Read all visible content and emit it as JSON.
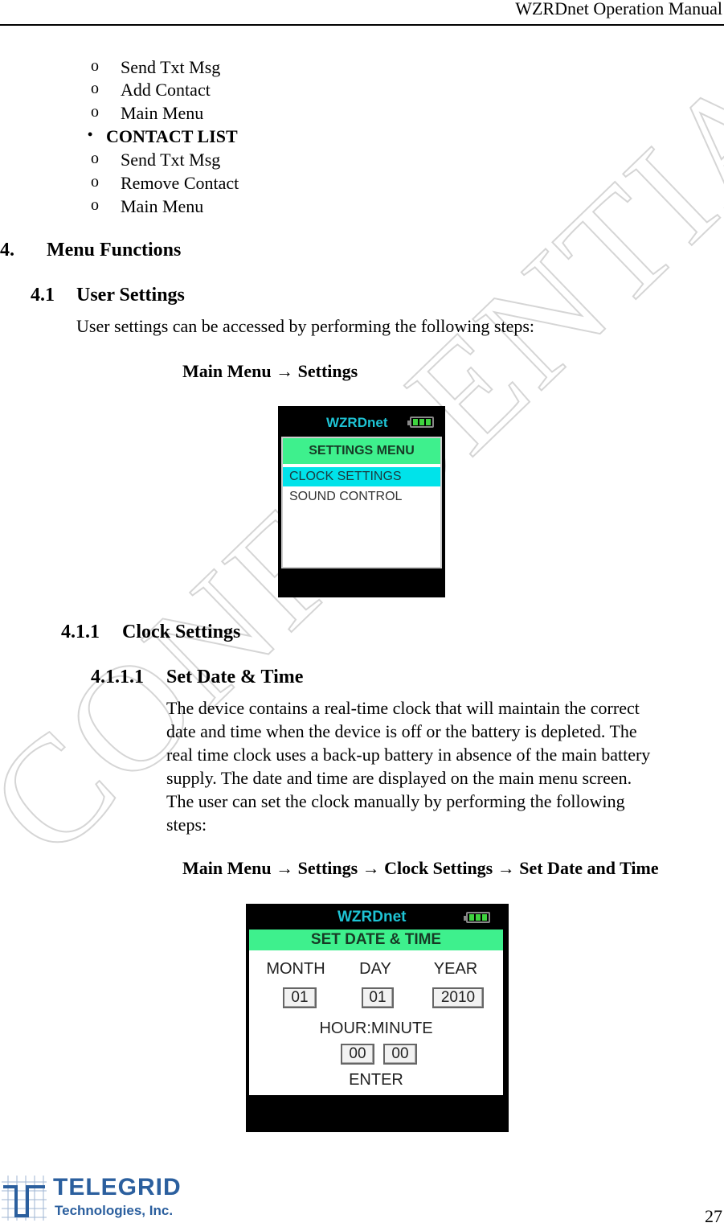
{
  "header": {
    "title": "WZRDnet Operation Manual"
  },
  "outline": {
    "top_subitems": [
      "Send Txt Msg",
      "Add Contact",
      "Main Menu"
    ],
    "contact_list": {
      "label": "CONTACT LIST",
      "subitems": [
        "Send Txt Msg",
        "Remove Contact",
        "Main Menu"
      ]
    },
    "bullets": {
      "hollow": "o",
      "solid": "•"
    }
  },
  "section4": {
    "number": "4.",
    "title": "Menu Functions",
    "s41": {
      "number": "4.1",
      "title": "User Settings",
      "intro": "User settings can be accessed by performing the following steps:",
      "path": "Main Menu → Settings",
      "screen": {
        "brand": "WZRDnet",
        "battery_level": "3 of 3 bars",
        "title": "SETTINGS MENU",
        "items": [
          {
            "label": "CLOCK SETTINGS",
            "selected": true
          },
          {
            "label": "SOUND CONTROL",
            "selected": false
          }
        ]
      }
    },
    "s411": {
      "number": "4.1.1",
      "title": "Clock Settings",
      "s4111": {
        "number": "4.1.1.1",
        "title": "Set Date & Time",
        "paragraph_lines": [
          "The device contains a real-time clock that will maintain the correct",
          "date and time when the device is off or the battery is depleted.  The",
          "real time clock uses a back-up battery in absence of the main battery",
          "supply.   The date and time are displayed on the main menu screen.",
          "The user can set the clock manually by performing the following",
          "steps:"
        ],
        "path": "Main Menu → Settings → Clock Settings → Set Date and Time",
        "screen": {
          "brand": "WZRDnet",
          "battery_level": "3 of 3 bars",
          "title": "SET DATE & TIME",
          "labels": {
            "month": "MONTH",
            "day": "DAY",
            "year": "YEAR",
            "hour_minute": "HOUR:MINUTE",
            "enter": "ENTER"
          },
          "values": {
            "month": "01",
            "day": "01",
            "year": "2010",
            "hour": "00",
            "minute": "00"
          }
        }
      }
    }
  },
  "watermark": "CONFIDENTIAL",
  "footer": {
    "logo_line1": "TELEGRID",
    "logo_line2": "Technologies, Inc.",
    "page_number": "27"
  },
  "colors": {
    "brand_cyan": "#1ec3d4",
    "menu_green": "#3ef08d",
    "selection_cyan": "#00e3ea",
    "battery_green": "#3fd33f",
    "logo_blue": "#2b5f9e"
  }
}
